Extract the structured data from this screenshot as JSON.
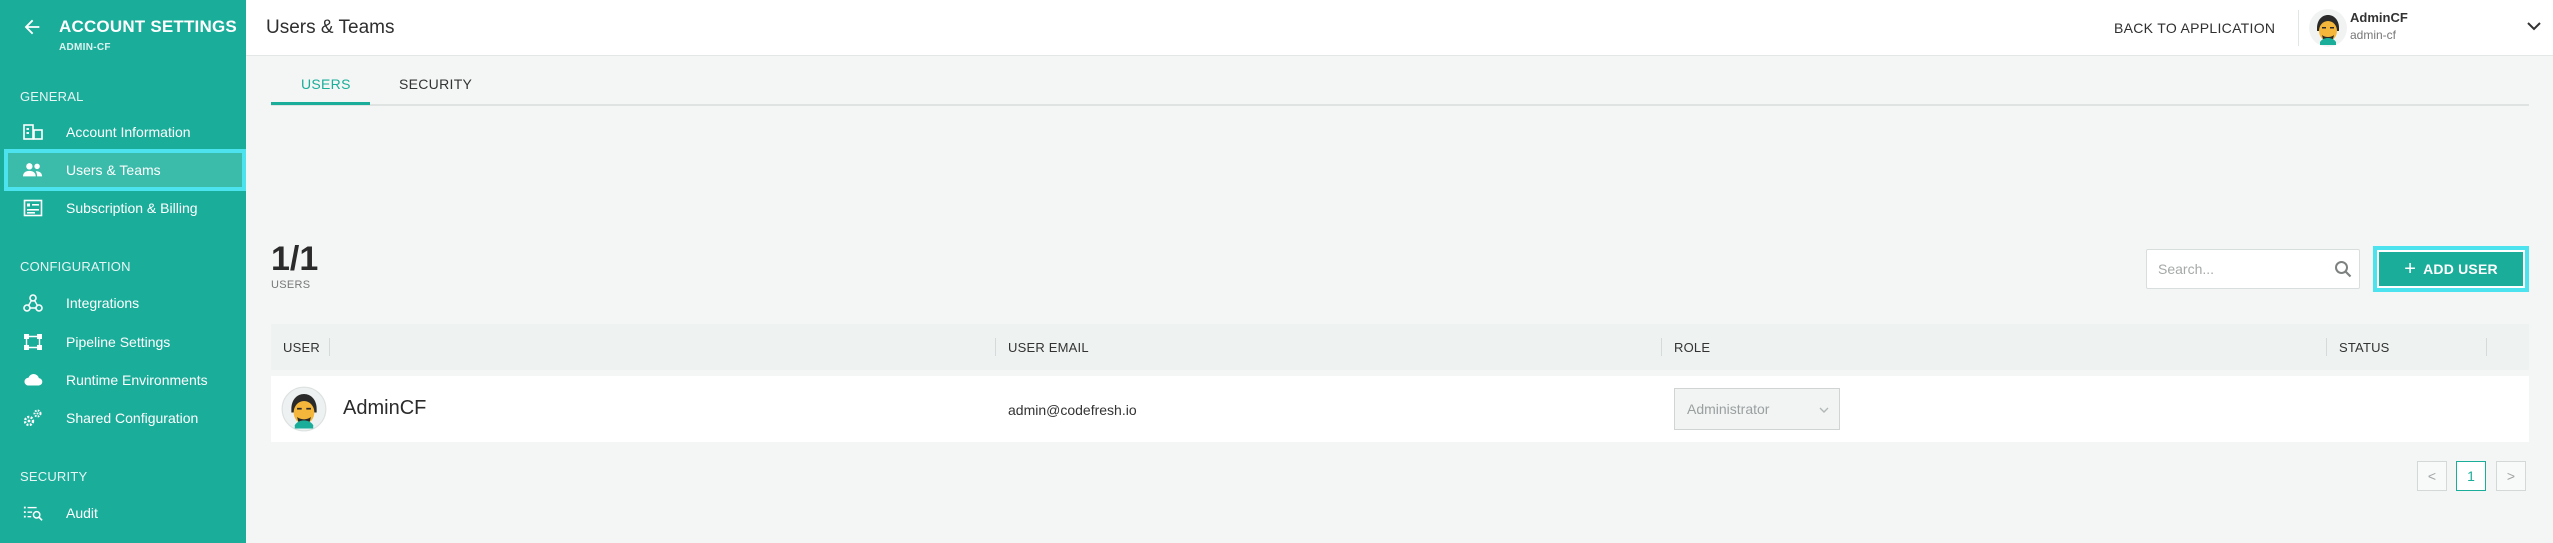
{
  "sidebar": {
    "title": "ACCOUNT SETTINGS",
    "subtitle": "ADMIN-CF",
    "sections": {
      "general": "GENERAL",
      "configuration": "CONFIGURATION",
      "security": "SECURITY"
    },
    "items": {
      "account_information": "Account Information",
      "users_teams": "Users & Teams",
      "subscription_billing": "Subscription & Billing",
      "integrations": "Integrations",
      "pipeline_settings": "Pipeline Settings",
      "runtime_environments": "Runtime Environments",
      "shared_configuration": "Shared Configuration",
      "audit": "Audit"
    },
    "active_item": "users_teams"
  },
  "header": {
    "title": "Users & Teams",
    "back_link": "BACK TO APPLICATION",
    "user": {
      "name": "AdminCF",
      "handle": "admin-cf"
    }
  },
  "tabs": {
    "users": "USERS",
    "security": "SECURITY",
    "active": "users"
  },
  "summary": {
    "count": "1/1",
    "label": "USERS"
  },
  "search": {
    "placeholder": "Search...",
    "value": ""
  },
  "add_button": {
    "label": "ADD USER"
  },
  "table": {
    "columns": {
      "user": "USER",
      "email": "USER EMAIL",
      "role": "ROLE",
      "status": "STATUS"
    },
    "rows": [
      {
        "name": "AdminCF",
        "email": "admin@codefresh.io",
        "role": "Administrator",
        "status": ""
      }
    ]
  },
  "pagination": {
    "prev": "<",
    "current": "1",
    "next": ">"
  },
  "colors": {
    "accent": "#1aad9a",
    "highlight": "#4de3ee"
  }
}
